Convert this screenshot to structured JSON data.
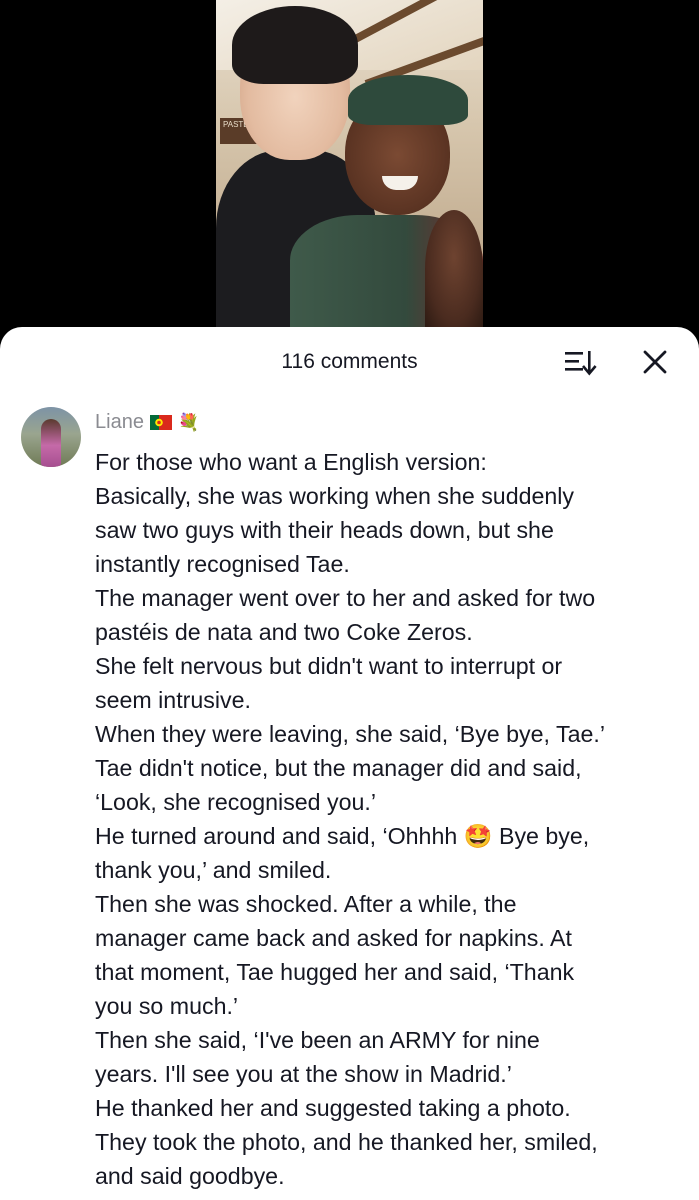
{
  "sheet": {
    "title": "116 comments",
    "sort_icon": "sort-icon",
    "close_icon": "close-icon"
  },
  "comment": {
    "username": "Liane",
    "badges": [
      "portugal-flag-icon",
      "bouquet-icon"
    ],
    "lines": [
      "For those who want a English version:",
      "Basically, she was working when she suddenly",
      "saw two guys with their heads down, but she",
      "instantly recognised Tae.",
      "The manager went over to her and asked for two",
      "pastéis de nata and two Coke Zeros.",
      "She felt nervous but didn't want to interrupt or",
      "seem intrusive.",
      "When they were leaving, she said, ‘Bye bye, Tae.’",
      "Tae didn't notice, but the manager did and said,",
      "‘Look, she recognised you.’",
      "He turned around and said, ‘Ohhhh 🤩 Bye bye,",
      "thank you,’ and smiled.",
      "Then she was shocked. After a while, the",
      "manager came back and asked for napkins. At",
      "that moment, Tae hugged her and said, ‘Thank",
      "you so much.’",
      "Then she said, ‘I've been an ARMY for nine",
      "years. I'll see you at the show in Madrid.’",
      "He thanked her and suggested taking a photo.",
      "They took the photo, and he thanked her, smiled,",
      "and said goodbye."
    ]
  },
  "colors": {
    "text_primary": "#161823",
    "text_secondary": "#8a8b91",
    "sheet_bg": "#ffffff",
    "video_bg": "#000000"
  }
}
